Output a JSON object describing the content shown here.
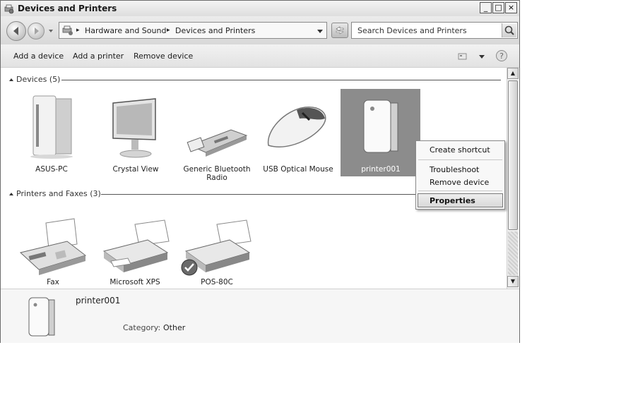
{
  "window": {
    "title": "Devices and Printers",
    "controls": {
      "minimize": "_",
      "maximize": "□",
      "close": "×"
    }
  },
  "nav": {
    "breadcrumb": [
      "Hardware and Sound",
      "Devices and Printers"
    ],
    "separator": "▸",
    "search_placeholder": "Search Devices and Printers"
  },
  "toolbar": {
    "add_device": "Add a device",
    "add_printer": "Add a printer",
    "remove_device": "Remove device"
  },
  "groups": {
    "devices": {
      "header": "Devices (5)",
      "items": [
        "ASUS-PC",
        "Crystal View",
        "Generic Bluetooth Radio",
        "USB Optical Mouse",
        "printer001"
      ]
    },
    "printers": {
      "header": "Printers and Faxes (3)",
      "items": [
        "Fax",
        "Microsoft XPS",
        "POS-80C"
      ]
    }
  },
  "context_menu": {
    "items": [
      "Create shortcut",
      "Troubleshoot",
      "Remove device",
      "Properties"
    ],
    "highlighted": "Properties"
  },
  "details": {
    "name": "printer001",
    "category_label": "Category:",
    "category_value": "Other"
  },
  "icons": [
    "back-icon",
    "forward-icon",
    "devices-folder-icon",
    "refresh-icon",
    "search-icon",
    "view-options-icon",
    "help-icon"
  ]
}
